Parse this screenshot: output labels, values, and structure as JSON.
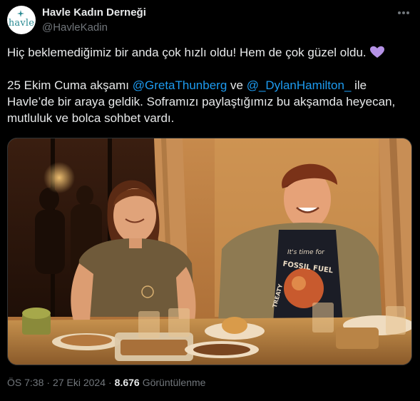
{
  "author": {
    "display_name": "Havle Kadın Derneği",
    "handle": "@HavleKadin",
    "avatar_text": "havle",
    "avatar_color": "#2a8a92"
  },
  "tweet": {
    "line1": "Hiç beklemediğimiz bir anda çok hızlı oldu! Hem de çok güzel oldu.",
    "heart_icon": "purple-heart-emoji",
    "heart_color": "#b592e6",
    "p2_prefix": "25 Ekim Cuma akşamı ",
    "mention1": "@GretaThunberg",
    "p2_mid": " ve ",
    "mention2": "@_DylanHamilton_",
    "p2_suffix": " ile Havle’de bir araya geldik. Soframızı paylaştığımız bu akşamda heyecan, mutluluk ve bolca sohbet vardı.",
    "mention_color": "#1d9bf0"
  },
  "media": {
    "shirt_text_1": "It's time for",
    "shirt_text_2": "FOSSIL FUEL",
    "shirt_text_3": "TREATY"
  },
  "meta": {
    "time": "ÖS 7:38",
    "dot": "·",
    "date": "27 Eki 2024",
    "views_count": "8.676",
    "views_label": "Görüntülenme"
  },
  "icons": {
    "more": "more-options-icon"
  }
}
